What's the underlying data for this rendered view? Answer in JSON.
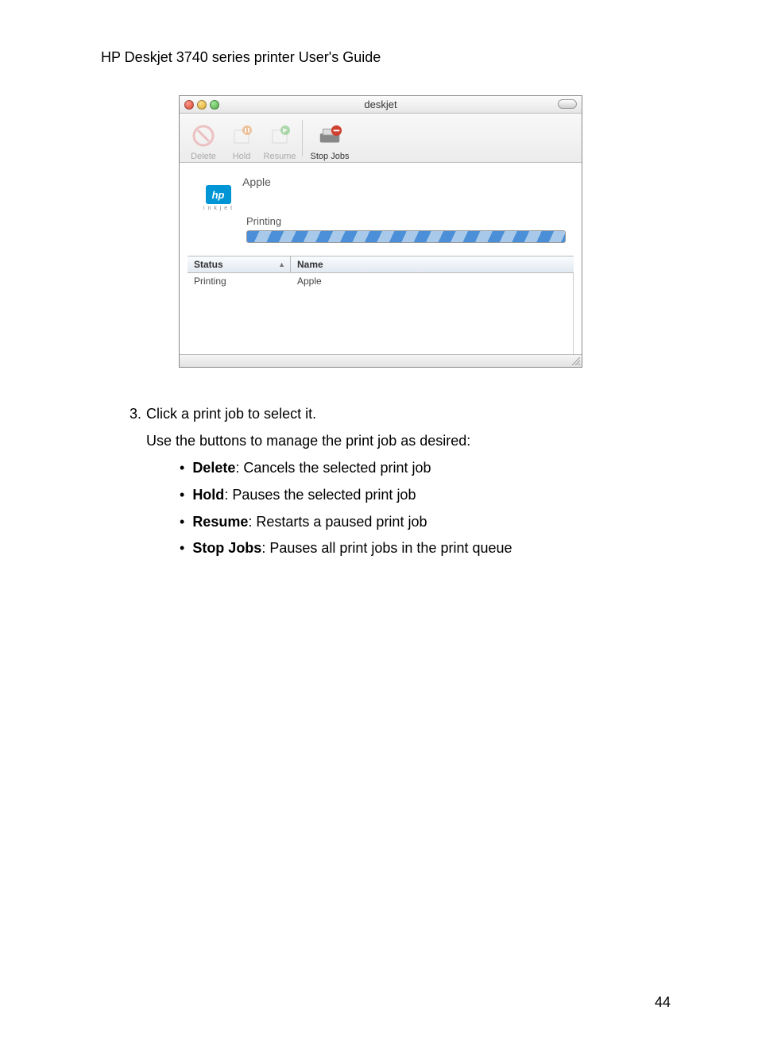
{
  "header": "HP Deskjet 3740 series printer User's Guide",
  "window": {
    "title": "deskjet",
    "toolbar": {
      "delete_label": "Delete",
      "hold_label": "Hold",
      "resume_label": "Resume",
      "stop_jobs_label": "Stop Jobs"
    },
    "current_job": {
      "name": "Apple",
      "status_label": "Printing"
    },
    "table": {
      "header_status": "Status",
      "header_name": "Name",
      "sort_indicator": "▲",
      "rows": [
        {
          "status": "Printing",
          "name": "Apple"
        }
      ]
    }
  },
  "article": {
    "step_number": "3.",
    "step_text": "Click a print job to select it.",
    "step_sub": "Use the buttons to manage the print job as desired:",
    "bullets": [
      {
        "label": "Delete",
        "desc": ": Cancels the selected print job"
      },
      {
        "label": "Hold",
        "desc": ": Pauses the selected print job"
      },
      {
        "label": "Resume",
        "desc": ": Restarts a paused print job"
      },
      {
        "label": "Stop Jobs",
        "desc": ": Pauses all print jobs in the print queue"
      }
    ]
  },
  "page_number": "44"
}
